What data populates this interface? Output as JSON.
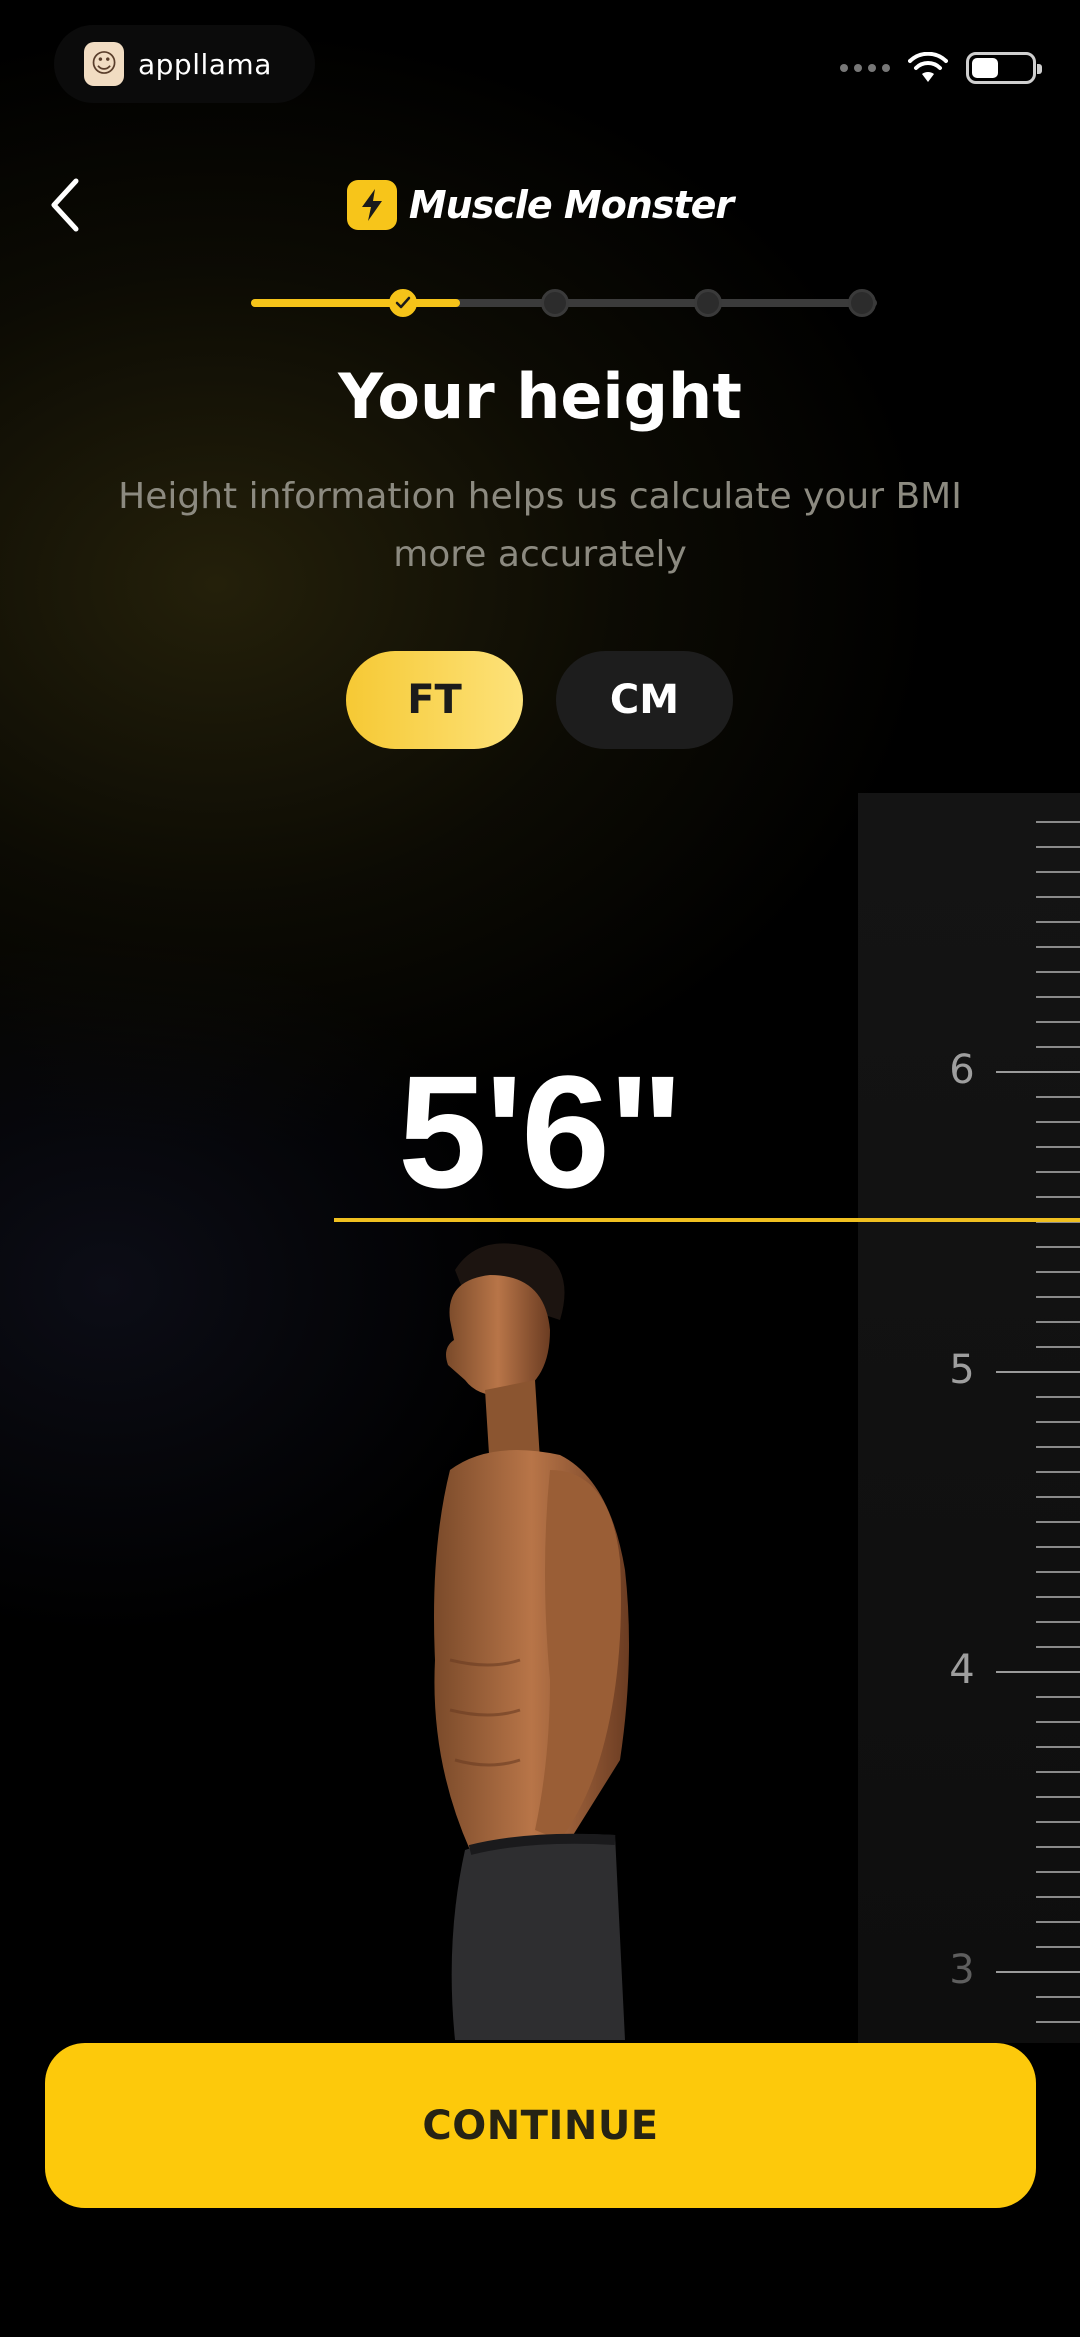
{
  "status_bar": {
    "app_pill_label": "appllama",
    "battery_icon": "battery-icon",
    "wifi_icon": "wifi-icon"
  },
  "header": {
    "back_icon": "chevron-left-icon",
    "brand_name": "Muscle Monster",
    "brand_icon": "lightning-bolt-icon"
  },
  "progress": {
    "total_steps": 5,
    "current_step": 1,
    "completed_icon": "check-icon"
  },
  "page": {
    "title": "Your height",
    "subtitle": "Height information helps us calculate your BMI more accurately"
  },
  "unit_toggle": {
    "options": [
      "FT",
      "CM"
    ],
    "selected": "FT"
  },
  "height": {
    "value_display": "5'6\"",
    "feet": 5,
    "inches": 6
  },
  "ruler": {
    "labels": [
      "6",
      "5",
      "4",
      "3"
    ]
  },
  "actions": {
    "continue_label": "CONTINUE"
  },
  "colors": {
    "accent": "#FDC90B",
    "background": "#000000",
    "muted_text": "#8C8A80"
  }
}
